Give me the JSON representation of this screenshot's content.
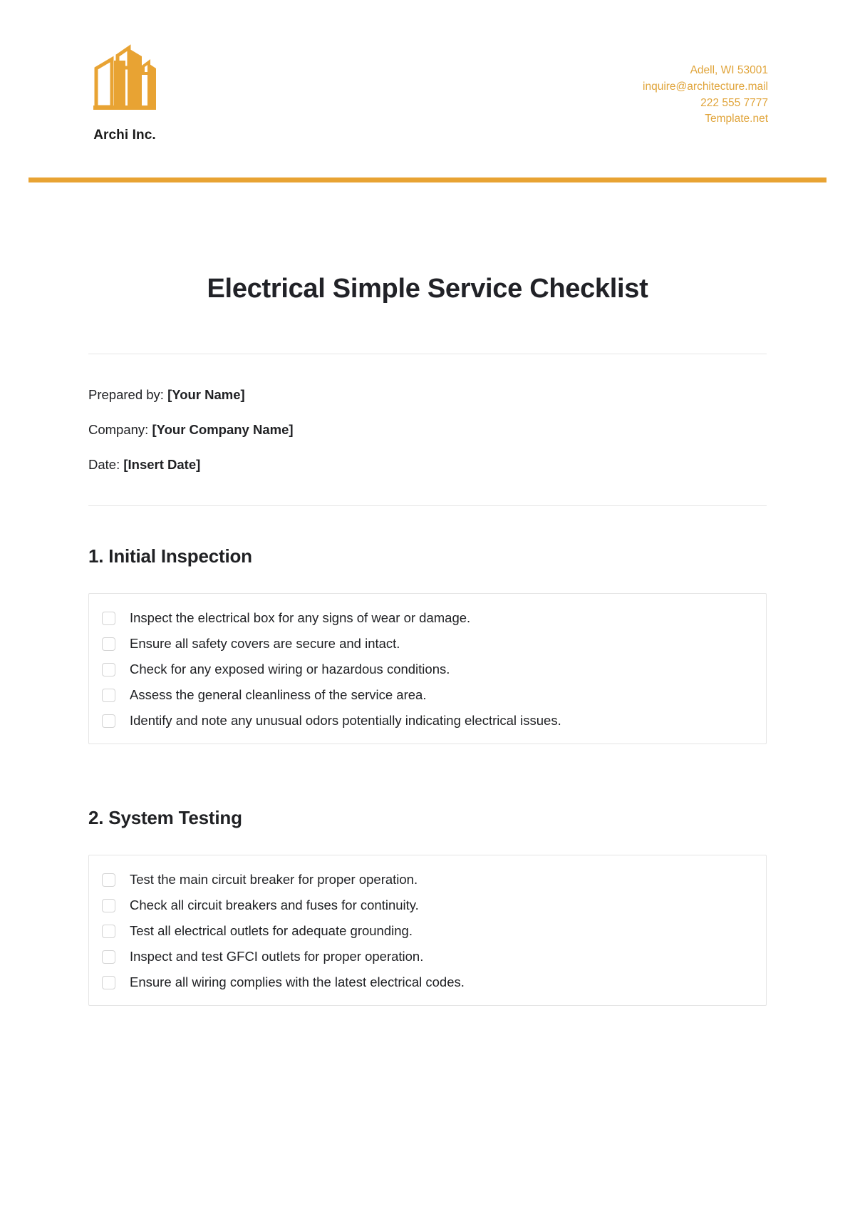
{
  "brand": {
    "name": "Archi Inc.",
    "logo_icon": "buildings-logo-icon",
    "accent_color": "#e8a333"
  },
  "contact": {
    "address": "Adell, WI 53001",
    "email": "inquire@architecture.mail",
    "phone": "222 555 7777",
    "website": "Template.net"
  },
  "document": {
    "title": "Electrical Simple Service Checklist"
  },
  "meta": [
    {
      "label": "Prepared by:",
      "value": "[Your Name]"
    },
    {
      "label": "Company:",
      "value": "[Your Company Name]"
    },
    {
      "label": "Date:",
      "value": "[Insert Date]"
    }
  ],
  "sections": [
    {
      "heading": "1. Initial Inspection",
      "items": [
        "Inspect the electrical box for any signs of wear or damage.",
        "Ensure all safety covers are secure and intact.",
        "Check for any exposed wiring or hazardous conditions.",
        "Assess the general cleanliness of the service area.",
        "Identify and note any unusual odors potentially indicating electrical issues."
      ]
    },
    {
      "heading": "2. System Testing",
      "items": [
        "Test the main circuit breaker for proper operation.",
        "Check all circuit breakers and fuses for continuity.",
        "Test all electrical outlets for adequate grounding.",
        "Inspect and test GFCI outlets for proper operation.",
        "Ensure all wiring complies with the latest electrical codes."
      ]
    }
  ]
}
